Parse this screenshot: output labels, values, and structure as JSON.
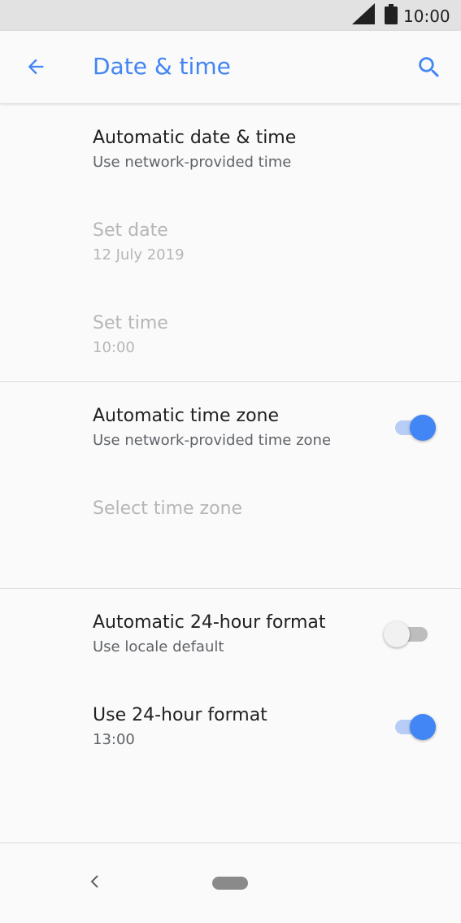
{
  "status_bar": {
    "time": "10:00",
    "icons": [
      "cell-signal-icon",
      "battery-icon"
    ]
  },
  "app_bar": {
    "title": "Date & time",
    "back_icon": "arrow-back-icon",
    "search_icon": "search-icon",
    "accent_color": "#4285f4"
  },
  "sections": {
    "date_time": {
      "auto_date_time": {
        "title": "Automatic date & time",
        "summary": "Use network-provided time"
      },
      "set_date": {
        "title": "Set date",
        "summary": "12 July 2019",
        "enabled": false
      },
      "set_time": {
        "title": "Set time",
        "summary": "10:00",
        "enabled": false
      }
    },
    "time_zone": {
      "auto_time_zone": {
        "title": "Automatic time zone",
        "summary": "Use network-provided time zone",
        "checked": true
      },
      "select_time_zone": {
        "title": "Select time zone",
        "enabled": false
      }
    },
    "time_format": {
      "auto_24_hour": {
        "title": "Automatic 24-hour format",
        "summary": "Use locale default",
        "checked": false
      },
      "use_24_hour": {
        "title": "Use 24-hour format",
        "summary": "13:00",
        "checked": true
      }
    }
  },
  "nav_bar": {
    "back_icon": "nav-back-icon",
    "home_icon": "home-pill-icon"
  }
}
